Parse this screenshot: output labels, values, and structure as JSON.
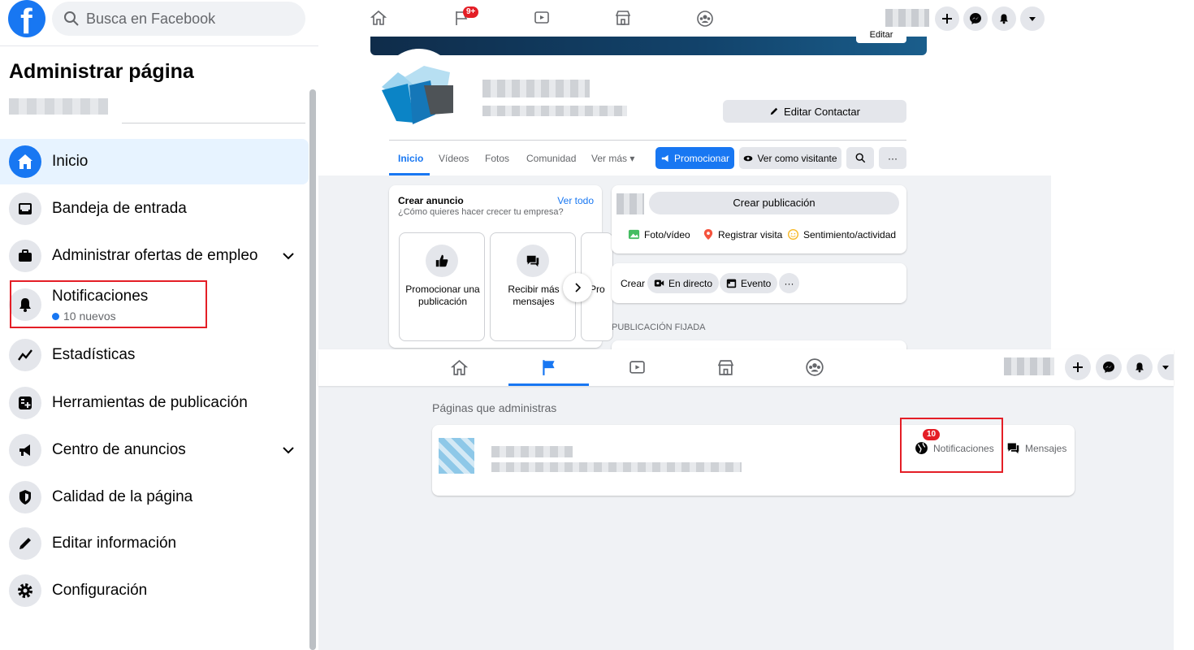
{
  "left": {
    "search_placeholder": "Busca en Facebook",
    "title": "Administrar página",
    "nav": [
      {
        "label": "Inicio"
      },
      {
        "label": "Bandeja de entrada"
      },
      {
        "label": "Administrar ofertas de empleo"
      },
      {
        "label": "Notificaciones",
        "sub": "10 nuevos"
      },
      {
        "label": "Estadísticas"
      },
      {
        "label": "Herramientas de publicación"
      },
      {
        "label": "Centro de anuncios"
      },
      {
        "label": "Calidad de la página"
      },
      {
        "label": "Editar información"
      },
      {
        "label": "Configuración"
      }
    ]
  },
  "top_right": {
    "header_badge": "9+",
    "cover_edit": "Editar",
    "edit_contact": "Editar Contactar",
    "tabs": [
      "Inicio",
      "Vídeos",
      "Fotos",
      "Comunidad",
      "Ver más ▾"
    ],
    "promote": "Promocionar",
    "view_as": "Ver como visitante",
    "more": "···",
    "ad": {
      "title": "Crear anuncio",
      "link": "Ver todo",
      "subtitle": "¿Cómo quieres hacer crecer tu empresa?",
      "cards": [
        "Promocionar una publicación",
        "Recibir más mensajes",
        "Pro"
      ]
    },
    "create_post": "Crear publicación",
    "post_actions": [
      "Foto/vídeo",
      "Registrar visita",
      "Sentimiento/actividad"
    ],
    "create_label": "Crear",
    "create_pills": [
      "En directo",
      "Evento"
    ],
    "pinned": "PUBLICACIÓN FIJADA"
  },
  "bottom": {
    "pages_title": "Páginas que administras",
    "notif_badge": "10",
    "notif_label": "Notificaciones",
    "messages_label": "Mensajes"
  },
  "colors": {
    "accent": "#1877f2",
    "highlight": "#e41e26",
    "background": "#f0f2f5"
  }
}
